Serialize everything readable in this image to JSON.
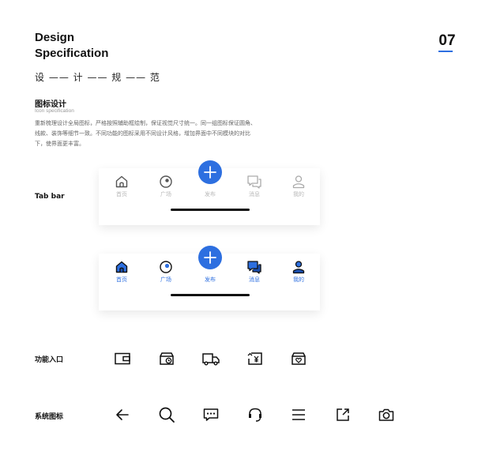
{
  "header": {
    "title_line1": "Design",
    "title_line2": "Specification",
    "page_number": "07",
    "subtitle": "设 —— 计 —— 规 —— 范"
  },
  "section": {
    "title": "图标设计",
    "subtitle": "Icon specification",
    "description": "重新梳理设计全局图标，严格按照辅助框绘制，保证视觉尺寸统一。同一组图标保证圆角、线款、装饰等细节一致。不同功能的图标采用不同设计风格，增加界面中不同模块的对比下，使界面更丰富。"
  },
  "tabbar_row": {
    "label": "Tab bar",
    "inactive": {
      "items": [
        "首页",
        "广场",
        "发布",
        "消息",
        "我的"
      ],
      "label_color": "#b8b8b8",
      "fab_label_color": "#b8b8b8"
    },
    "active": {
      "items": [
        "首页",
        "广场",
        "发布",
        "消息",
        "我的"
      ],
      "label_color": "#2d6fe0",
      "fab_label_color": "#2d6fe0"
    },
    "accent_color": "#2d6fe0"
  },
  "function_row": {
    "label": "功能入口",
    "icons": [
      "wallet-icon",
      "store-clock-icon",
      "truck-icon",
      "yen-return-icon",
      "store-heart-icon"
    ]
  },
  "system_row": {
    "label": "系统图标",
    "icons": [
      "arrow-left-icon",
      "search-icon",
      "chat-bubble-icon",
      "headset-icon",
      "menu-icon",
      "external-link-icon",
      "camera-icon"
    ]
  }
}
